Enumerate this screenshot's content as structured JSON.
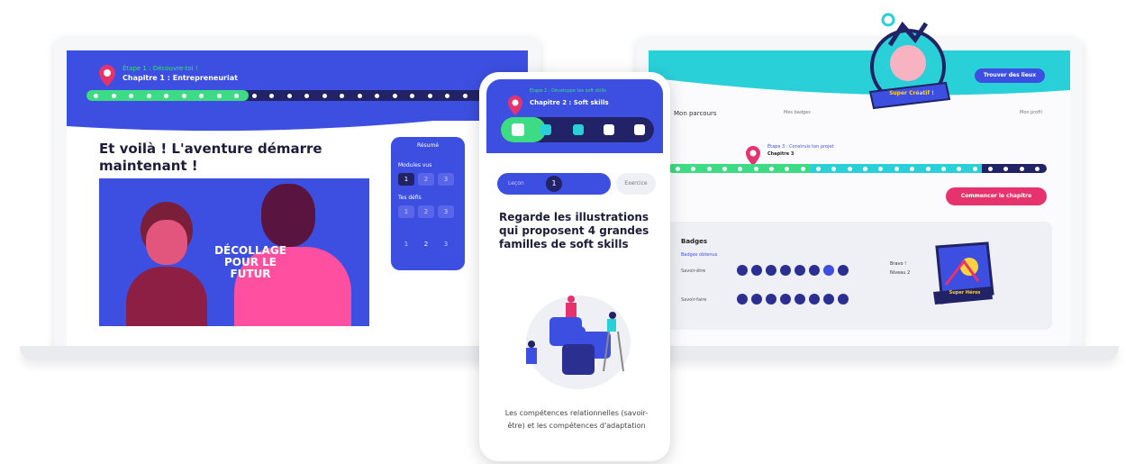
{
  "left_screen": {
    "breadcrumb_sub": "Étape 1 : Découvre-toi !",
    "chapter_title": "Chapitre 1 : Entrepreneuriat",
    "heading": "Et voilà ! L'aventure démarre maintenant !",
    "video_title": "DÉCOLLAGE POUR LE FUTUR",
    "side_panel": {
      "title": "Résumé",
      "section1": "Modules vus",
      "section2": "Tes défis",
      "cells_row1": [
        "1",
        "2",
        "3"
      ],
      "cells_row2": [
        "1",
        "2",
        "3"
      ],
      "cells_row3": [
        "1",
        "2",
        "3"
      ]
    }
  },
  "phone": {
    "breadcrumb_sub": "Étape 2 : Développe tes soft skills",
    "chapter_title": "Chapitre 2 : Soft skills",
    "toggle_left": "Leçon",
    "toggle_num": "1",
    "toggle_right": "Exercice",
    "heading": "Regarde les illustrations qui proposent 4 grandes familles de soft skills",
    "caption": "Les compétences relationnelles (savoir-être) et les compétences d'adaptation"
  },
  "right_screen": {
    "button_top": "Trouver des lieux",
    "nav_left": "Mon parcours",
    "nav_mid": "Mes badges",
    "nav_right": "Mon profil",
    "track_sub": "Étape 3 : Construis ton projet",
    "track_title": "Chapitre 3",
    "cta_button": "Commencer le chapitre",
    "card_title": "Badges",
    "card_sub": "Badges obtenus",
    "row1_label": "Savoir-être",
    "row2_label": "Savoir-faire",
    "right_text1": "Bravo !",
    "right_text2": "Niveau 2",
    "badge_top_label": "Super Créatif !",
    "badge_card_label": "Super Héros"
  },
  "colors": {
    "primary_blue": "#3c4fe0",
    "navy": "#222266",
    "green": "#3ddc84",
    "pink": "#e6336e",
    "teal": "#2ad0d8"
  }
}
